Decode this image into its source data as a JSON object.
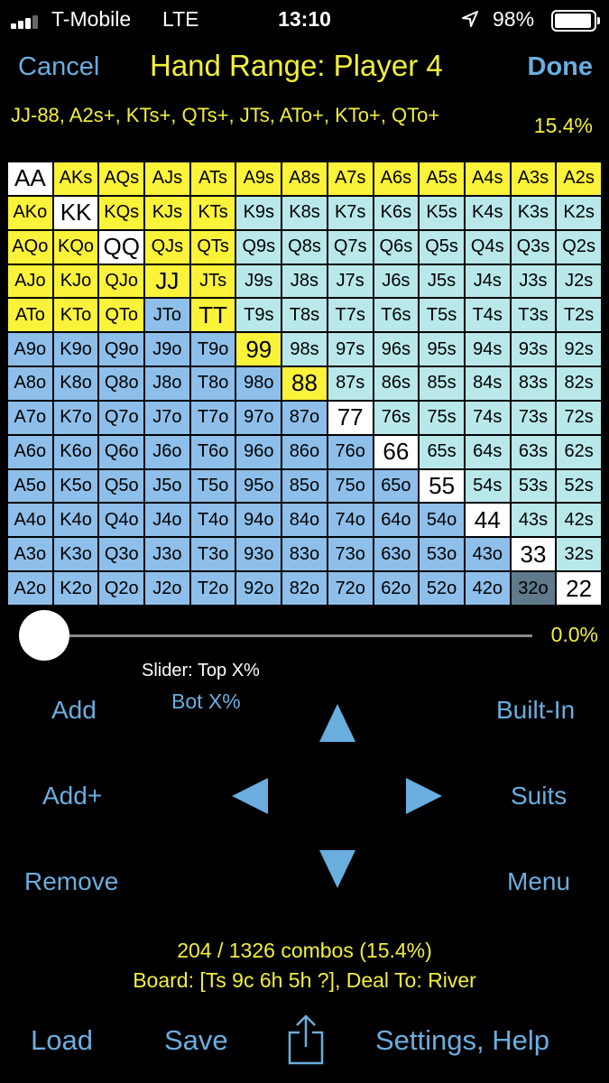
{
  "status_bar": {
    "carrier": "T-Mobile",
    "network": "LTE",
    "time": "13:10",
    "battery": "98%",
    "icons": [
      "signal-icon",
      "location-icon",
      "battery-icon"
    ]
  },
  "nav": {
    "cancel": "Cancel",
    "title": "Hand Range: Player 4",
    "done": "Done"
  },
  "range": {
    "text": "JJ-88, A2s+, KTs+, QTs+, JTs, ATo+, KTo+, QTo+",
    "percent": "15.4%"
  },
  "colors": {
    "accent": "#6aaee0",
    "yellow_text": "#f2ef3a",
    "selected": "#fbf23a",
    "pair": "#ffffff",
    "suited": "#b9e8ea",
    "offsuit": "#8ebfea",
    "highlight": "#607a8c"
  },
  "grid": [
    [
      [
        "AA",
        "white"
      ],
      [
        "AKs",
        "yellow"
      ],
      [
        "AQs",
        "yellow"
      ],
      [
        "AJs",
        "yellow"
      ],
      [
        "ATs",
        "yellow"
      ],
      [
        "A9s",
        "yellow"
      ],
      [
        "A8s",
        "yellow"
      ],
      [
        "A7s",
        "yellow"
      ],
      [
        "A6s",
        "yellow"
      ],
      [
        "A5s",
        "yellow"
      ],
      [
        "A4s",
        "yellow"
      ],
      [
        "A3s",
        "yellow"
      ],
      [
        "A2s",
        "yellow"
      ]
    ],
    [
      [
        "AKo",
        "yellow"
      ],
      [
        "KK",
        "white"
      ],
      [
        "KQs",
        "yellow"
      ],
      [
        "KJs",
        "yellow"
      ],
      [
        "KTs",
        "yellow"
      ],
      [
        "K9s",
        "suited"
      ],
      [
        "K8s",
        "suited"
      ],
      [
        "K7s",
        "suited"
      ],
      [
        "K6s",
        "suited"
      ],
      [
        "K5s",
        "suited"
      ],
      [
        "K4s",
        "suited"
      ],
      [
        "K3s",
        "suited"
      ],
      [
        "K2s",
        "suited"
      ]
    ],
    [
      [
        "AQo",
        "yellow"
      ],
      [
        "KQo",
        "yellow"
      ],
      [
        "QQ",
        "white"
      ],
      [
        "QJs",
        "yellow"
      ],
      [
        "QTs",
        "yellow"
      ],
      [
        "Q9s",
        "suited"
      ],
      [
        "Q8s",
        "suited"
      ],
      [
        "Q7s",
        "suited"
      ],
      [
        "Q6s",
        "suited"
      ],
      [
        "Q5s",
        "suited"
      ],
      [
        "Q4s",
        "suited"
      ],
      [
        "Q3s",
        "suited"
      ],
      [
        "Q2s",
        "suited"
      ]
    ],
    [
      [
        "AJo",
        "yellow"
      ],
      [
        "KJo",
        "yellow"
      ],
      [
        "QJo",
        "yellow"
      ],
      [
        "JJ",
        "yellow"
      ],
      [
        "JTs",
        "yellow"
      ],
      [
        "J9s",
        "suited"
      ],
      [
        "J8s",
        "suited"
      ],
      [
        "J7s",
        "suited"
      ],
      [
        "J6s",
        "suited"
      ],
      [
        "J5s",
        "suited"
      ],
      [
        "J4s",
        "suited"
      ],
      [
        "J3s",
        "suited"
      ],
      [
        "J2s",
        "suited"
      ]
    ],
    [
      [
        "ATo",
        "yellow"
      ],
      [
        "KTo",
        "yellow"
      ],
      [
        "QTo",
        "yellow"
      ],
      [
        "JTo",
        "offsuit"
      ],
      [
        "TT",
        "yellow"
      ],
      [
        "T9s",
        "suited"
      ],
      [
        "T8s",
        "suited"
      ],
      [
        "T7s",
        "suited"
      ],
      [
        "T6s",
        "suited"
      ],
      [
        "T5s",
        "suited"
      ],
      [
        "T4s",
        "suited"
      ],
      [
        "T3s",
        "suited"
      ],
      [
        "T2s",
        "suited"
      ]
    ],
    [
      [
        "A9o",
        "offsuit"
      ],
      [
        "K9o",
        "offsuit"
      ],
      [
        "Q9o",
        "offsuit"
      ],
      [
        "J9o",
        "offsuit"
      ],
      [
        "T9o",
        "offsuit"
      ],
      [
        "99",
        "yellow"
      ],
      [
        "98s",
        "suited"
      ],
      [
        "97s",
        "suited"
      ],
      [
        "96s",
        "suited"
      ],
      [
        "95s",
        "suited"
      ],
      [
        "94s",
        "suited"
      ],
      [
        "93s",
        "suited"
      ],
      [
        "92s",
        "suited"
      ]
    ],
    [
      [
        "A8o",
        "offsuit"
      ],
      [
        "K8o",
        "offsuit"
      ],
      [
        "Q8o",
        "offsuit"
      ],
      [
        "J8o",
        "offsuit"
      ],
      [
        "T8o",
        "offsuit"
      ],
      [
        "98o",
        "offsuit"
      ],
      [
        "88",
        "yellow"
      ],
      [
        "87s",
        "suited"
      ],
      [
        "86s",
        "suited"
      ],
      [
        "85s",
        "suited"
      ],
      [
        "84s",
        "suited"
      ],
      [
        "83s",
        "suited"
      ],
      [
        "82s",
        "suited"
      ]
    ],
    [
      [
        "A7o",
        "offsuit"
      ],
      [
        "K7o",
        "offsuit"
      ],
      [
        "Q7o",
        "offsuit"
      ],
      [
        "J7o",
        "offsuit"
      ],
      [
        "T7o",
        "offsuit"
      ],
      [
        "97o",
        "offsuit"
      ],
      [
        "87o",
        "offsuit"
      ],
      [
        "77",
        "white"
      ],
      [
        "76s",
        "suited"
      ],
      [
        "75s",
        "suited"
      ],
      [
        "74s",
        "suited"
      ],
      [
        "73s",
        "suited"
      ],
      [
        "72s",
        "suited"
      ]
    ],
    [
      [
        "A6o",
        "offsuit"
      ],
      [
        "K6o",
        "offsuit"
      ],
      [
        "Q6o",
        "offsuit"
      ],
      [
        "J6o",
        "offsuit"
      ],
      [
        "T6o",
        "offsuit"
      ],
      [
        "96o",
        "offsuit"
      ],
      [
        "86o",
        "offsuit"
      ],
      [
        "76o",
        "offsuit"
      ],
      [
        "66",
        "white"
      ],
      [
        "65s",
        "suited"
      ],
      [
        "64s",
        "suited"
      ],
      [
        "63s",
        "suited"
      ],
      [
        "62s",
        "suited"
      ]
    ],
    [
      [
        "A5o",
        "offsuit"
      ],
      [
        "K5o",
        "offsuit"
      ],
      [
        "Q5o",
        "offsuit"
      ],
      [
        "J5o",
        "offsuit"
      ],
      [
        "T5o",
        "offsuit"
      ],
      [
        "95o",
        "offsuit"
      ],
      [
        "85o",
        "offsuit"
      ],
      [
        "75o",
        "offsuit"
      ],
      [
        "65o",
        "offsuit"
      ],
      [
        "55",
        "white"
      ],
      [
        "54s",
        "suited"
      ],
      [
        "53s",
        "suited"
      ],
      [
        "52s",
        "suited"
      ]
    ],
    [
      [
        "A4o",
        "offsuit"
      ],
      [
        "K4o",
        "offsuit"
      ],
      [
        "Q4o",
        "offsuit"
      ],
      [
        "J4o",
        "offsuit"
      ],
      [
        "T4o",
        "offsuit"
      ],
      [
        "94o",
        "offsuit"
      ],
      [
        "84o",
        "offsuit"
      ],
      [
        "74o",
        "offsuit"
      ],
      [
        "64o",
        "offsuit"
      ],
      [
        "54o",
        "offsuit"
      ],
      [
        "44",
        "white"
      ],
      [
        "43s",
        "suited"
      ],
      [
        "42s",
        "suited"
      ]
    ],
    [
      [
        "A3o",
        "offsuit"
      ],
      [
        "K3o",
        "offsuit"
      ],
      [
        "Q3o",
        "offsuit"
      ],
      [
        "J3o",
        "offsuit"
      ],
      [
        "T3o",
        "offsuit"
      ],
      [
        "93o",
        "offsuit"
      ],
      [
        "83o",
        "offsuit"
      ],
      [
        "73o",
        "offsuit"
      ],
      [
        "63o",
        "offsuit"
      ],
      [
        "53o",
        "offsuit"
      ],
      [
        "43o",
        "offsuit"
      ],
      [
        "33",
        "white"
      ],
      [
        "32s",
        "suited"
      ]
    ],
    [
      [
        "A2o",
        "offsuit"
      ],
      [
        "K2o",
        "offsuit"
      ],
      [
        "Q2o",
        "offsuit"
      ],
      [
        "J2o",
        "offsuit"
      ],
      [
        "T2o",
        "offsuit"
      ],
      [
        "92o",
        "offsuit"
      ],
      [
        "82o",
        "offsuit"
      ],
      [
        "72o",
        "offsuit"
      ],
      [
        "62o",
        "offsuit"
      ],
      [
        "52o",
        "offsuit"
      ],
      [
        "42o",
        "offsuit"
      ],
      [
        "32o",
        "gray"
      ],
      [
        "22",
        "white"
      ]
    ]
  ],
  "slider": {
    "value_pct": 0.0,
    "value_label": "0.0%",
    "label": "Slider: Top X%",
    "bot_label": "Bot X%"
  },
  "controls": {
    "add": "Add",
    "add_plus": "Add+",
    "remove": "Remove",
    "built_in": "Built-In",
    "suits": "Suits",
    "menu": "Menu"
  },
  "info": {
    "combos": "204 / 1326 combos (15.4%)",
    "board": "Board: [Ts 9c 6h 5h ?], Deal To: River"
  },
  "toolbar": {
    "load": "Load",
    "save": "Save",
    "settings": "Settings, Help"
  }
}
